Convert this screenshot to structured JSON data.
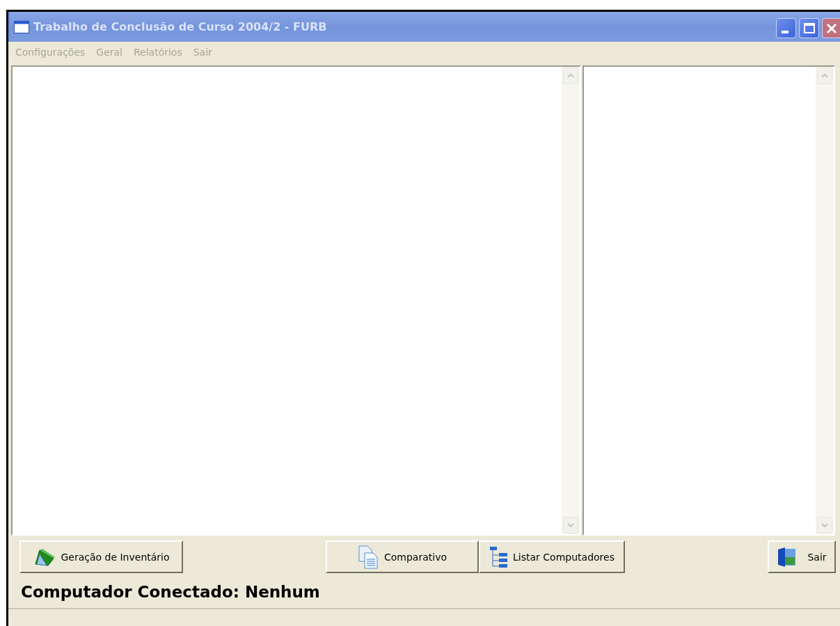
{
  "window": {
    "title": "Trabalho de Conclusão de Curso 2004/2 - FURB"
  },
  "menu": [
    {
      "label": "Configurações",
      "disabled": true
    },
    {
      "label": "Geral",
      "disabled": true
    },
    {
      "label": "Relatórios",
      "disabled": true
    },
    {
      "label": "Sair",
      "disabled": true
    }
  ],
  "buttons": [
    {
      "label": "Geração de Inventário",
      "kind": "inventory"
    },
    {
      "label": "Comparativo",
      "kind": "compare"
    },
    {
      "label": "Listar Computadores",
      "kind": "tree"
    },
    {
      "label": "Sair",
      "kind": "exit"
    }
  ],
  "status_label": "Computador Conectado: Nenhum"
}
